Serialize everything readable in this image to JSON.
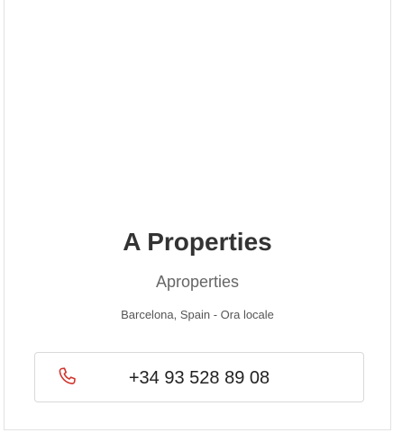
{
  "agent": {
    "name": "A Properties",
    "company": "Aproperties",
    "location": "Barcelona, Spain - Ora locale"
  },
  "contact": {
    "phone": "+34 93 528 89 08",
    "icon": "phone-icon"
  },
  "colors": {
    "accent": "#d0342c",
    "title": "#333333",
    "muted": "#666666",
    "border": "#d9d9d9"
  }
}
